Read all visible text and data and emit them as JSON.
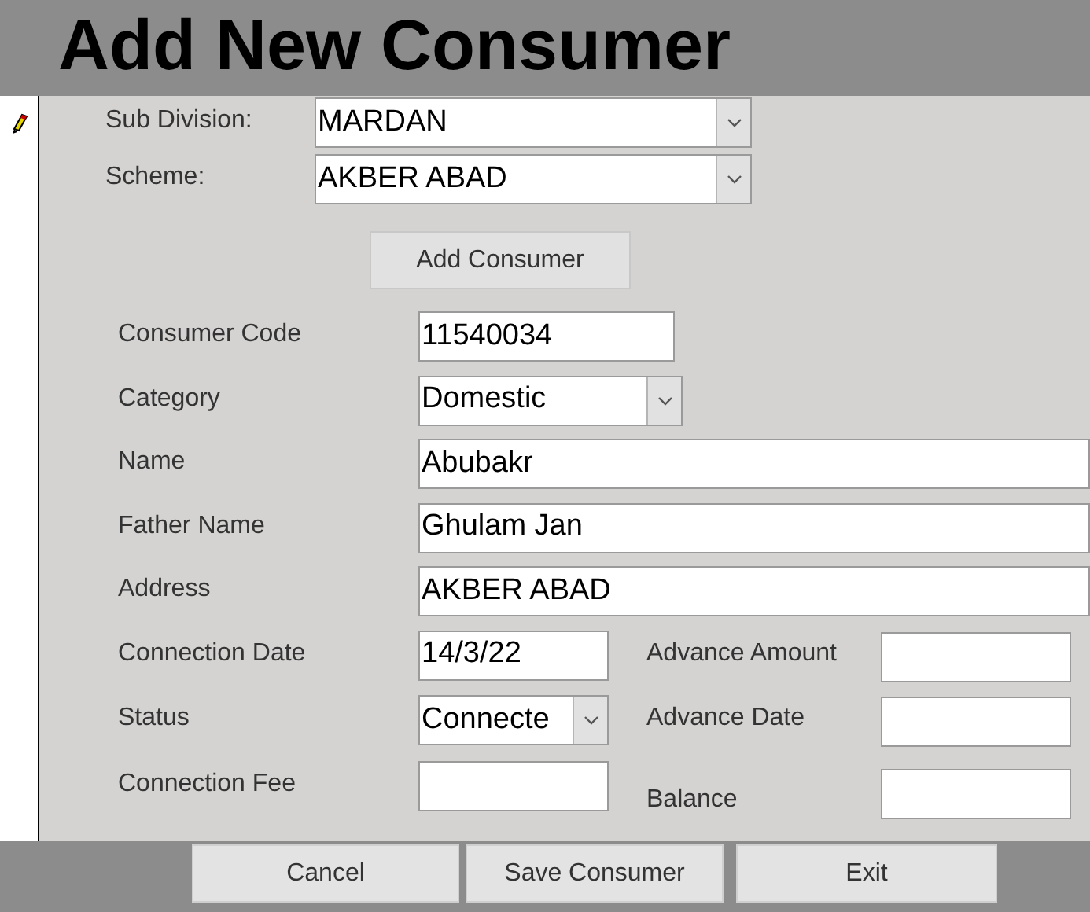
{
  "title": "Add New Consumer",
  "record_selector": {
    "editing": true
  },
  "header_fields": [
    {
      "label": "Sub Division:",
      "value": "MARDAN"
    },
    {
      "label": "Scheme:",
      "value": "AKBER ABAD"
    }
  ],
  "add_button": "Add Consumer",
  "fields": [
    {
      "label": "Consumer Code",
      "value": "11540034",
      "kind": "text"
    },
    {
      "label": "Category",
      "value": "Domestic",
      "kind": "combo"
    },
    {
      "label": "Name",
      "value": "Abubakr",
      "kind": "text"
    },
    {
      "label": "Father Name",
      "value": "Ghulam Jan",
      "kind": "text"
    },
    {
      "label": "Address",
      "value": "AKBER ABAD",
      "kind": "text"
    },
    {
      "label": "Connection Date",
      "value": "14/3/22",
      "kind": "text",
      "side": {
        "label": "Advance Amount"
      }
    },
    {
      "label": "Status",
      "value": "Connecte",
      "kind": "combo",
      "side": {
        "label": "Advance Date"
      }
    },
    {
      "label": "Connection Fee",
      "kind": "text",
      "side": {
        "label": "Balance"
      }
    }
  ],
  "buttons": [
    "Cancel",
    "Save Consumer",
    "Exit"
  ]
}
